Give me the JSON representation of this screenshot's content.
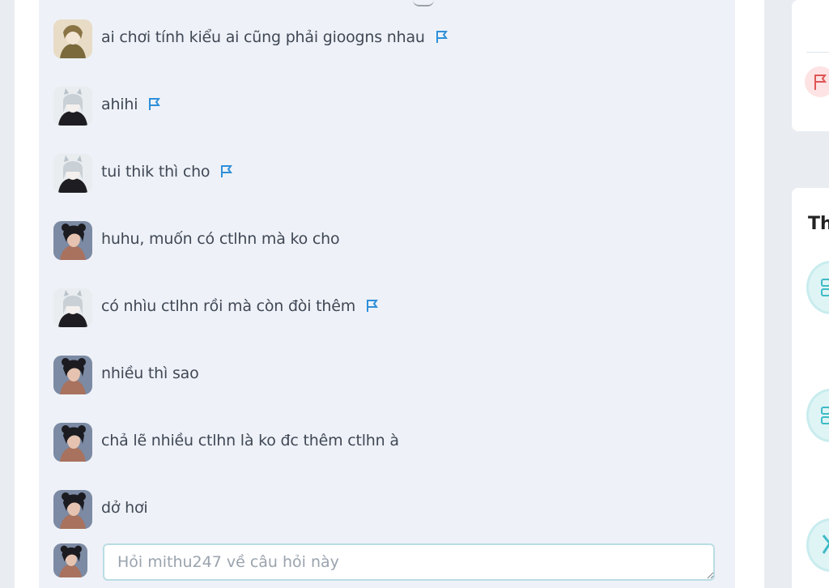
{
  "comments": [
    {
      "text": "ai chơi tính kiểu ai cũng phải gioogns nhau",
      "avatar": "avatar-girl-brown-hat",
      "flag": true
    },
    {
      "text": "ahihi",
      "avatar": "avatar-white-hair",
      "flag": true
    },
    {
      "text": "tui thik thì cho",
      "avatar": "avatar-white-hair",
      "flag": true
    },
    {
      "text": "huhu, muốn có ctlhn mà ko cho",
      "avatar": "avatar-dark-hair",
      "flag": false
    },
    {
      "text": "có nhìu ctlhn rồi mà còn đòi thêm",
      "avatar": "avatar-white-hair",
      "flag": true
    },
    {
      "text": "nhiều thì sao",
      "avatar": "avatar-dark-hair",
      "flag": false
    },
    {
      "text": "chả lẽ nhiều ctlhn là ko đc thêm ctlhn à",
      "avatar": "avatar-dark-hair",
      "flag": false
    },
    {
      "text": "dở hơi",
      "avatar": "avatar-dark-hair",
      "flag": false
    }
  ],
  "reply": {
    "placeholder": "Hỏi mithu247 về câu hỏi này"
  },
  "sidebar": {
    "heading": "Th"
  },
  "colors": {
    "panel_bg": "#eef2f8",
    "flag_blue": "#2f8fd8",
    "input_border": "#b9dde3",
    "report_red": "#e05555"
  }
}
